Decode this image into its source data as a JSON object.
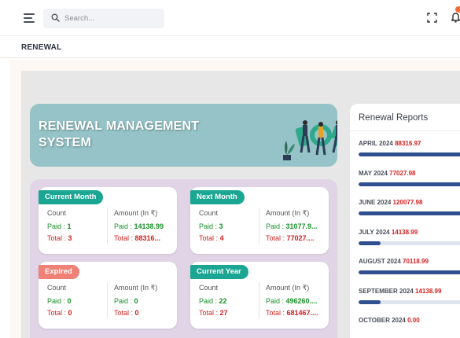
{
  "header": {
    "search_placeholder": "Search..."
  },
  "breadcrumb": {
    "title": "RENEWAL"
  },
  "banner": {
    "title": "RENEWAL MANAGEMENT SYSTEM"
  },
  "cards": [
    {
      "tag": "Current Month",
      "tag_color": "#1aa693",
      "count_label": "Count",
      "amount_label": "Amount (In ₹)",
      "paid_label": "Paid : ",
      "paid_count": "1",
      "total_label": "Total : ",
      "total_count": "3",
      "paid_amount": "14138.99",
      "total_amount": "88316..."
    },
    {
      "tag": "Next Month",
      "tag_color": "#1aa693",
      "count_label": "Count",
      "amount_label": "Amount (In ₹)",
      "paid_label": "Paid : ",
      "paid_count": "3",
      "total_label": "Total : ",
      "total_count": "4",
      "paid_amount": "31077.9...",
      "total_amount": "77027...."
    },
    {
      "tag": "Expired",
      "tag_color": "#f08176",
      "count_label": "Count",
      "amount_label": "Amount (In ₹)",
      "paid_label": "Paid : ",
      "paid_count": "0",
      "total_label": "Total : ",
      "total_count": "0",
      "paid_amount": "0",
      "total_amount": "0"
    },
    {
      "tag": "Current Year",
      "tag_color": "#1aa693",
      "count_label": "Count",
      "amount_label": "Amount (In ₹)",
      "paid_label": "Paid : ",
      "paid_count": "22",
      "total_label": "Total : ",
      "total_count": "27",
      "paid_amount": "496260....",
      "total_amount": "681467...."
    }
  ],
  "reports": {
    "title": "Renewal Reports",
    "items": [
      {
        "month": "APRIL 2024",
        "value": "88316.97",
        "progress": 1.0
      },
      {
        "month": "MAY 2024",
        "value": "77027.98",
        "progress": 1.0
      },
      {
        "month": "JUNE 2024",
        "value": "120077.98",
        "progress": 1.0
      },
      {
        "month": "JULY 2024",
        "value": "14138.99",
        "progress": 0.2
      },
      {
        "month": "AUGUST 2024",
        "value": "70118.99",
        "progress": 1.0
      },
      {
        "month": "SEPTEMBER 2024",
        "value": "14138.99",
        "progress": 0.2
      },
      {
        "month": "OCTOBER 2024",
        "value": "0.00",
        "progress": 0
      }
    ]
  },
  "colors": {
    "accent": "#2f4f8f",
    "paid": "#1b8f2a",
    "total": "#d42020",
    "banner": "#95c3c7",
    "panel": "#e0d4e6"
  }
}
